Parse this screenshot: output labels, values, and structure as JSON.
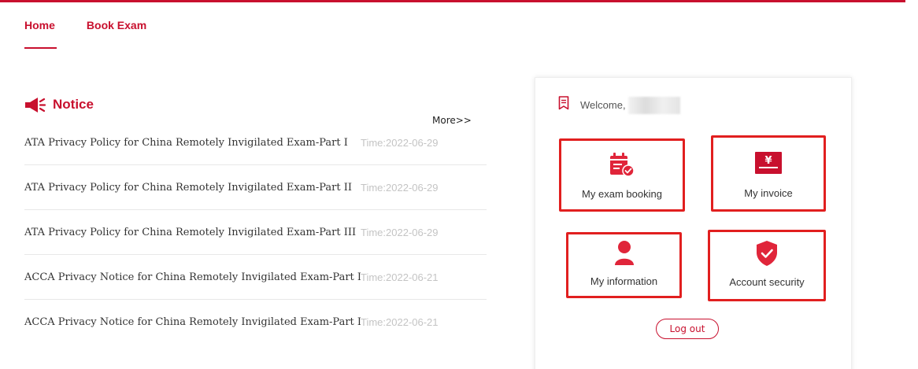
{
  "nav": {
    "items": [
      {
        "label": "Home",
        "active": true
      },
      {
        "label": "Book Exam",
        "active": false
      }
    ]
  },
  "notice": {
    "title": "Notice",
    "more_label": "More>>",
    "items": [
      {
        "title": "ATA Privacy Policy for China Remotely Invigilated Exam-Part I",
        "time": "Time:2022-06-29"
      },
      {
        "title": "ATA Privacy Policy for China Remotely Invigilated Exam-Part II",
        "time": "Time:2022-06-29"
      },
      {
        "title": "ATA Privacy Policy for China Remotely Invigilated Exam-Part III",
        "time": "Time:2022-06-29"
      },
      {
        "title": "ACCA Privacy Notice for China Remotely Invigilated Exam-Part I",
        "time": "Time:2022-06-21"
      },
      {
        "title": "ACCA Privacy Notice for China Remotely Invigilated Exam-Part II",
        "time": "Time:2022-06-21"
      }
    ]
  },
  "account": {
    "welcome": "Welcome,",
    "tiles": [
      {
        "label": "My exam booking",
        "icon": "calendar-check-icon"
      },
      {
        "label": "My invoice",
        "icon": "yen-invoice-icon"
      },
      {
        "label": "My information",
        "icon": "user-icon"
      },
      {
        "label": "Account security",
        "icon": "shield-check-icon"
      }
    ],
    "logout_label": "Log out"
  },
  "colors": {
    "brand": "#c8102e",
    "tile_border": "#e11f1f",
    "muted_time": "#c4c4c4"
  }
}
